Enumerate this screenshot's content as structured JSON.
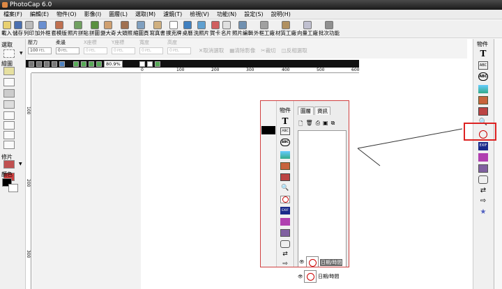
{
  "window": {
    "title": "PhotoCap 6.0"
  },
  "menu": [
    "檔案(F)",
    "編輯(E)",
    "物件(O)",
    "影像(I)",
    "圖層(L)",
    "選取(M)",
    "濾鏡(T)",
    "檢視(V)",
    "功能(N)",
    "設定(S)",
    "說明(H)"
  ],
  "toolbar": [
    "載入",
    "儲存",
    "列印",
    "加外框",
    "套模版",
    "照片拼貼",
    "拼圖",
    "變大奇",
    "大頭照",
    "縮圖頁",
    "寫真書",
    "撲克牌",
    "桌曆",
    "洗照片",
    "賀卡",
    "名片",
    "照片編輯",
    "外框工廠",
    "材質工廠",
    "向量工廠",
    "批次功能"
  ],
  "left_panel": {
    "select_label": "選取",
    "draw_label": "繪圖",
    "retouch_label": "修片",
    "color_label": "顏色"
  },
  "properties": {
    "pressure_label": "壓力",
    "pressure_value": "100",
    "feather_label": "柔邊",
    "feather_value": "0",
    "x_label": "X座標",
    "x_value": "0",
    "y_label": "Y座標",
    "y_value": "0",
    "width_label": "寬度",
    "width_value": "0",
    "height_label": "高度",
    "height_value": "0",
    "unit": "PEL",
    "actions": [
      "取消選取",
      "清除影像",
      "裁切",
      "反相選取"
    ]
  },
  "canvas": {
    "zoom": "80.9%",
    "ruler_top": [
      "0",
      "100",
      "200",
      "300",
      "400",
      "500",
      "600"
    ],
    "ruler_left": [
      "100",
      "200",
      "300"
    ]
  },
  "right_panel": {
    "title": "物件",
    "icons": [
      "text-T-icon",
      "text-abc-icon",
      "text-abc-bold-icon",
      "image-icon",
      "frame-icon",
      "photo-stack-icon",
      "magnifier-icon",
      "clock-icon",
      "exif-icon",
      "cake-icon",
      "calendar-icon",
      "speech-bubble-icon",
      "arrows-icon",
      "arrow-right-icon",
      "star-icon"
    ]
  },
  "inset": {
    "tool_title": "物件",
    "tabs": [
      "圖層",
      "資訊"
    ],
    "layers": [
      {
        "label": "日期/時間",
        "selected": true
      },
      {
        "label": "日期/時間",
        "selected": false
      }
    ]
  },
  "colors": {
    "highlight": "#dd2222",
    "titlebar": "#2a2a2a"
  }
}
